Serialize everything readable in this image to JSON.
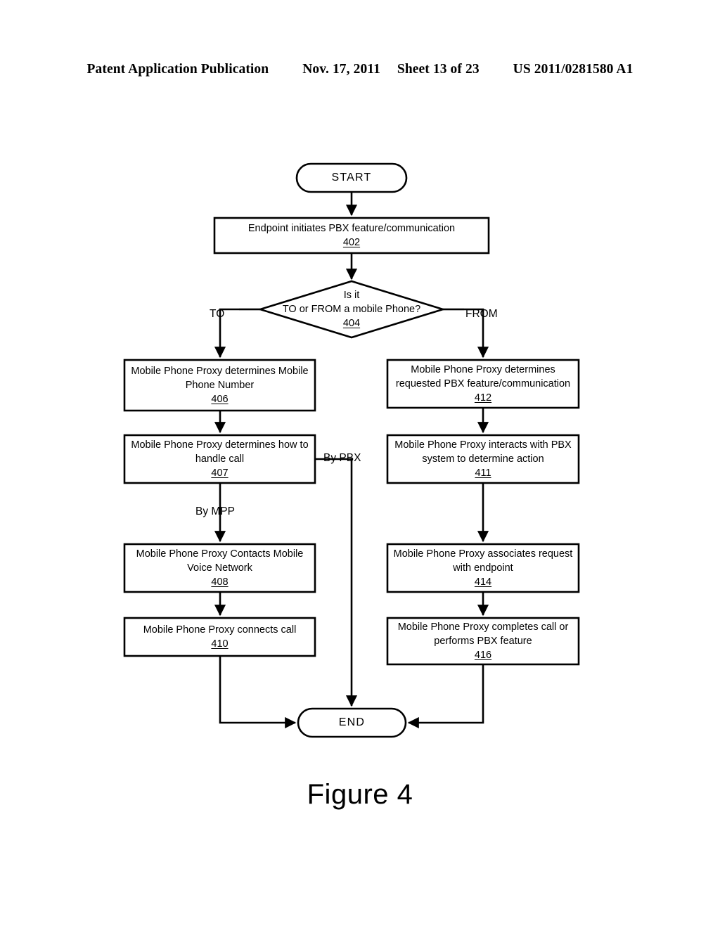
{
  "header": {
    "publication": "Patent Application Publication",
    "date": "Nov. 17, 2011",
    "sheet": "Sheet 13 of 23",
    "patent_number": "US 2011/0281580 A1"
  },
  "figure": {
    "caption": "Figure 4"
  },
  "flowchart": {
    "stroke_color": "#000000",
    "fill_color": "#ffffff",
    "nodes": {
      "start": {
        "label": "START",
        "shape": "terminal"
      },
      "end": {
        "label": "END",
        "shape": "terminal"
      },
      "n402": {
        "shape": "process",
        "lines": [
          "Endpoint initiates PBX feature/communication"
        ],
        "ref": "402"
      },
      "n404": {
        "shape": "decision",
        "lines": [
          "Is it",
          "TO or FROM a mobile Phone?"
        ],
        "ref": "404"
      },
      "n406": {
        "shape": "process",
        "lines": [
          "Mobile Phone Proxy determines Mobile",
          "Phone Number"
        ],
        "ref": "406"
      },
      "n407": {
        "shape": "process",
        "lines": [
          "Mobile Phone Proxy determines how to",
          "handle call"
        ],
        "ref": "407"
      },
      "n408": {
        "shape": "process",
        "lines": [
          "Mobile Phone Proxy Contacts Mobile",
          "Voice Network"
        ],
        "ref": "408"
      },
      "n410": {
        "shape": "process",
        "lines": [
          "Mobile Phone Proxy connects call"
        ],
        "ref": "410"
      },
      "n412": {
        "shape": "process",
        "lines": [
          "Mobile Phone Proxy determines",
          "requested PBX feature/communication"
        ],
        "ref": "412"
      },
      "n411": {
        "shape": "process",
        "lines": [
          "Mobile Phone Proxy interacts with PBX",
          "system to determine action"
        ],
        "ref": "411"
      },
      "n414": {
        "shape": "process",
        "lines": [
          "Mobile Phone Proxy associates request",
          "with endpoint"
        ],
        "ref": "414"
      },
      "n416": {
        "shape": "process",
        "lines": [
          "Mobile Phone Proxy completes call or",
          "performs PBX feature"
        ],
        "ref": "416"
      }
    },
    "edge_labels": {
      "to": "TO",
      "from": "FROM",
      "by_pbx": "By PBX",
      "by_mpp": "By MPP"
    }
  }
}
